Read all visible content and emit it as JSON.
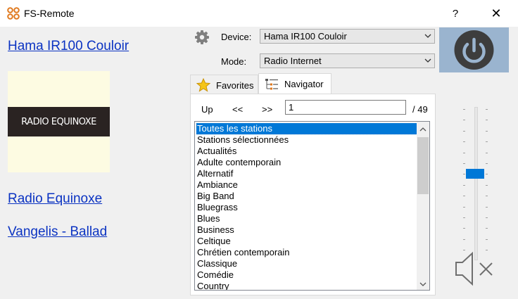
{
  "window": {
    "title": "FS-Remote",
    "help": "?",
    "close": "✕"
  },
  "left": {
    "device_link": "Hama IR100 Couloir",
    "logo_text": "RADIO EQUINOXE",
    "station_link": "Radio Equinoxe",
    "track_link": "Vangelis - Ballad"
  },
  "controls": {
    "device_label": "Device:",
    "device_value": "Hama IR100 Couloir",
    "mode_label": "Mode:",
    "mode_value": "Radio Internet"
  },
  "tabs": [
    {
      "label": "Favorites",
      "icon": "star-icon",
      "active": false
    },
    {
      "label": "Navigator",
      "icon": "tree-list-icon",
      "active": true
    }
  ],
  "navigator": {
    "up_label": "Up",
    "prev_label": "<<",
    "next_label": ">>",
    "page_value": "1",
    "page_total": "/ 49",
    "items": [
      "Toutes les stations",
      "Stations sélectionnées",
      "Actualités",
      "Adulte contemporain",
      "Alternatif",
      "Ambiance",
      "Big Band",
      "Bluegrass",
      "Blues",
      "Business",
      "Celtique",
      "Chrétien contemporain",
      "Classique",
      "Comédie",
      "Country"
    ],
    "selected_index": 0
  },
  "volume": {
    "level": 0.56,
    "muted": true
  },
  "colors": {
    "accent": "#0078d7",
    "link": "#0b33c2",
    "power_bg": "#9ab4cf",
    "power_icon": "#3d3d3d",
    "logo_icon": "#e07a1f"
  }
}
